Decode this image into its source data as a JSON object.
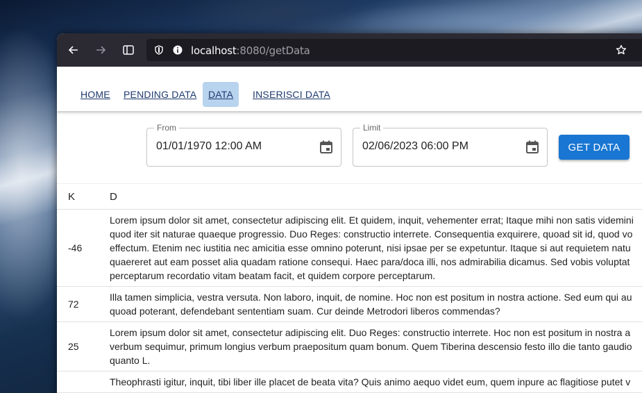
{
  "browser": {
    "url_host": "localhost",
    "url_rest": ":8080/getData"
  },
  "nav": {
    "items": [
      {
        "label": "HOME"
      },
      {
        "label": "PENDING DATA"
      },
      {
        "label": "DATA"
      },
      {
        "label": "INSERISCI DATA"
      }
    ],
    "active_index": 2
  },
  "filters": {
    "from": {
      "label": "From",
      "value": "01/01/1970 12:00 AM"
    },
    "limit": {
      "label": "Limit",
      "value": "02/06/2023 06:00 PM"
    },
    "submit_label": "GET DATA"
  },
  "table": {
    "columns": [
      "K",
      "D"
    ],
    "rows": [
      {
        "k": "-46",
        "d": [
          "Lorem ipsum dolor sit amet, consectetur adipiscing elit. Et quidem, inquit, vehementer errat; Itaque mihi non satis videmini",
          "quod iter sit naturae quaeque progressio. Duo Reges: constructio interrete. Consequentia exquirere, quoad sit id, quod vo",
          "effectum. Etenim nec iustitia nec amicitia esse omnino poterunt, nisi ipsae per se expetuntur. Itaque si aut requietem natu",
          "quaereret aut eam posset alia quadam ratione consequi. Haec para/doca illi, nos admirabilia dicamus. Sed vobis voluptat",
          "perceptarum recordatio vitam beatam facit, et quidem corpore perceptarum."
        ]
      },
      {
        "k": "72",
        "d": [
          "Illa tamen simplicia, vestra versuta. Non laboro, inquit, de nomine. Hoc non est positum in nostra actione. Sed eum qui au",
          "quoad poterant, defendebant sententiam suam. Cur deinde Metrodori liberos commendas?"
        ]
      },
      {
        "k": "25",
        "d": [
          "Lorem ipsum dolor sit amet, consectetur adipiscing elit. Duo Reges: constructio interrete. Hoc non est positum in nostra a",
          "verbum sequimur, primum longius verbum praepositum quam bonum. Quem Tiberina descensio festo illo die tanto gaudio",
          "quanto L."
        ]
      },
      {
        "k": "",
        "d": [
          "Theophrasti igitur, inquit, tibi liber ille placet de beata vita? Quis animo aequo videt eum, quem inpure ac flagitiose putet v"
        ]
      }
    ]
  },
  "icons": {
    "back": "arrow-left-icon",
    "forward": "arrow-right-icon",
    "sidebar": "sidebar-icon",
    "shield": "shield-icon",
    "info": "info-icon",
    "bookmark": "star-icon",
    "calendar": "calendar-icon"
  },
  "colors": {
    "primary": "#1976d2",
    "nav_active_bg": "#b8d3ee",
    "nav_link": "#1e3a6e",
    "toolbar_bg": "#2b2a33"
  }
}
